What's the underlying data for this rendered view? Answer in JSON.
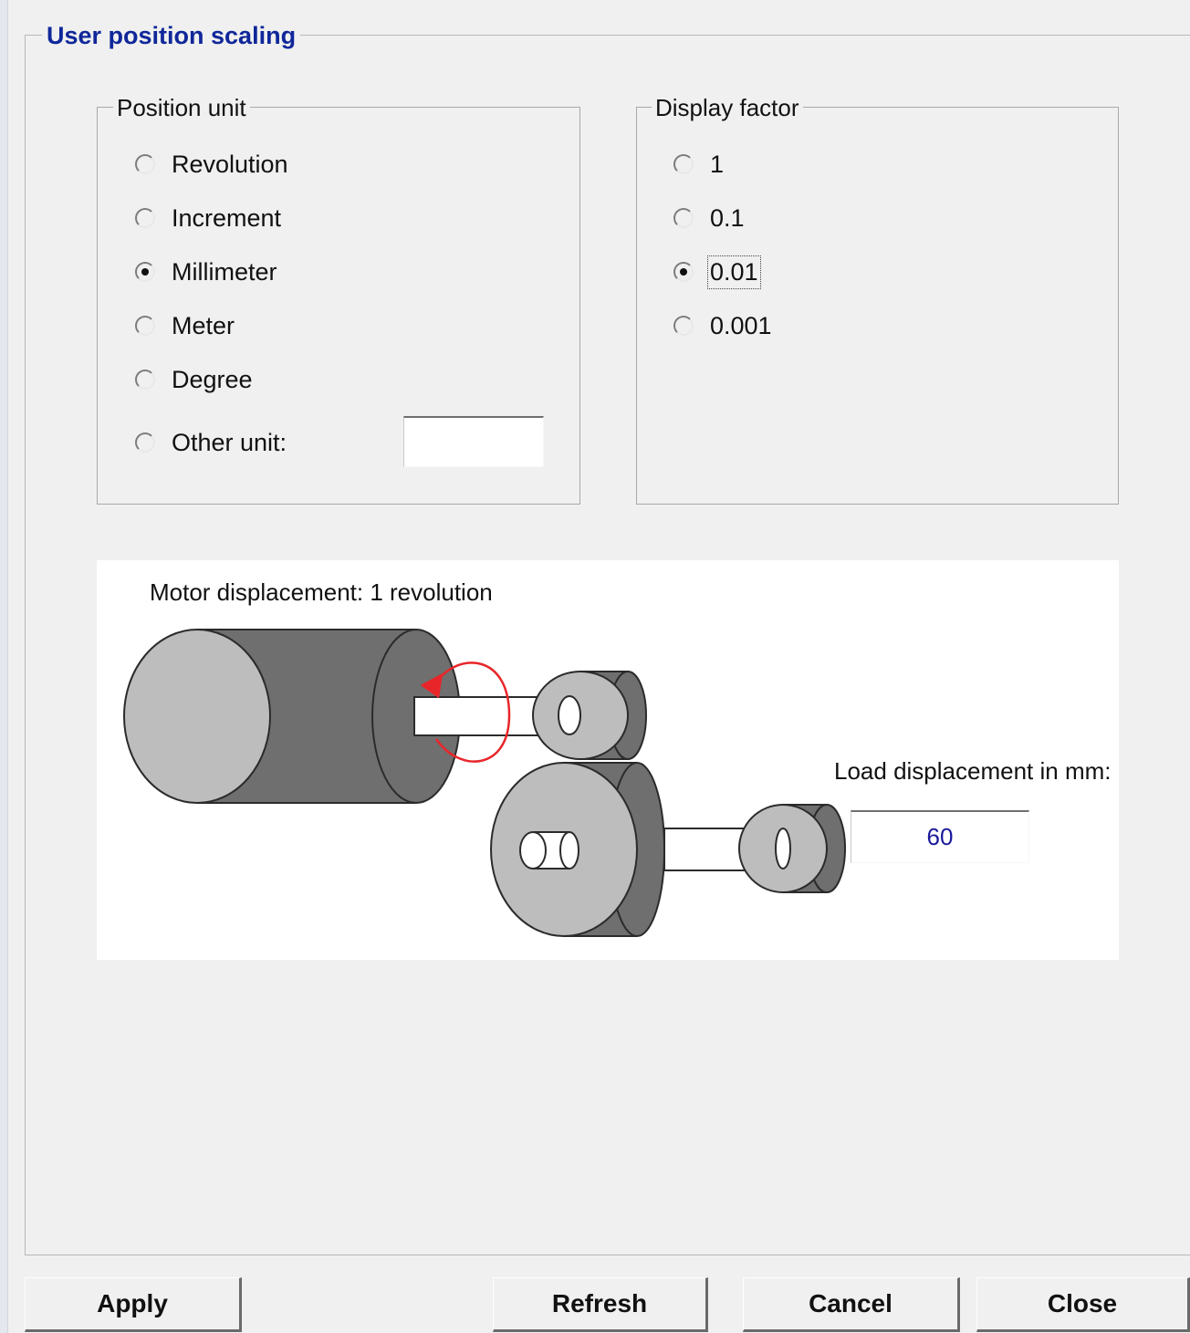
{
  "scaling": {
    "title": "User position scaling"
  },
  "position_unit": {
    "legend": "Position unit",
    "options": [
      {
        "label": "Revolution",
        "checked": false
      },
      {
        "label": "Increment",
        "checked": false
      },
      {
        "label": "Millimeter",
        "checked": true
      },
      {
        "label": "Meter",
        "checked": false
      },
      {
        "label": "Degree",
        "checked": false
      },
      {
        "label": "Other unit:",
        "checked": false
      }
    ],
    "other_unit_value": ""
  },
  "display_factor": {
    "legend": "Display factor",
    "options": [
      {
        "label": "1",
        "checked": false
      },
      {
        "label": "0.1",
        "checked": false
      },
      {
        "label": "0.01",
        "checked": true
      },
      {
        "label": "0.001",
        "checked": false
      }
    ]
  },
  "diagram": {
    "motor_caption": "Motor displacement: 1 revolution",
    "load_caption": "Load displacement in mm:",
    "load_value": "60",
    "colors": {
      "arrow": "#e8262a",
      "value_text": "#1a1a9c"
    }
  },
  "buttons": {
    "apply": "Apply",
    "refresh": "Refresh",
    "cancel": "Cancel",
    "close": "Close"
  }
}
